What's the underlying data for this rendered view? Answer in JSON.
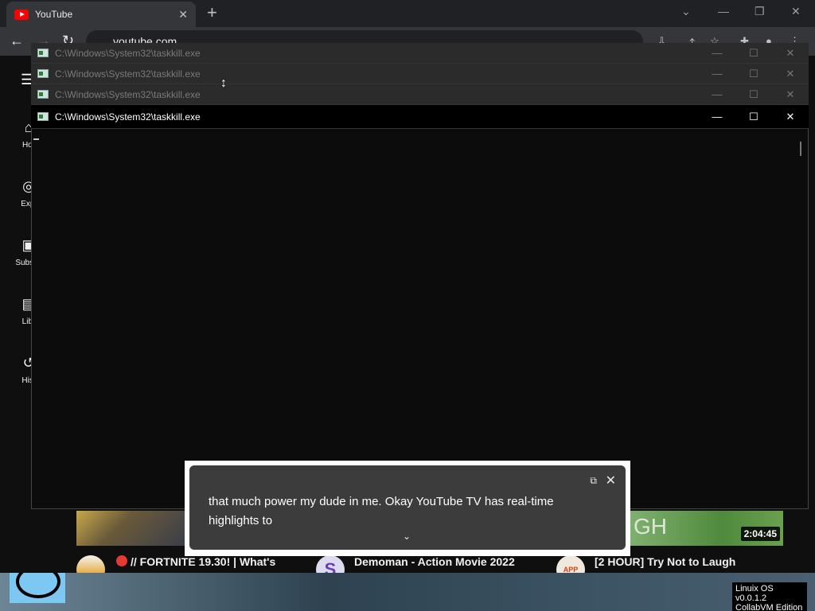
{
  "browser": {
    "tab_title": "YouTube",
    "tab_close": "✕",
    "new_tab": "+",
    "address": "youtube.com",
    "controls": {
      "dropdown": "⌄",
      "minimize": "—",
      "restore": "❐",
      "close": "✕"
    }
  },
  "youtube": {
    "sidebar": [
      {
        "label": "Hor",
        "icon": "home-icon"
      },
      {
        "label": "Expl",
        "icon": "explore-icon"
      },
      {
        "label": "Subscri",
        "icon": "subscriptions-icon"
      },
      {
        "label": "Libr",
        "icon": "library-icon"
      },
      {
        "label": "Hist",
        "icon": "history-icon"
      }
    ],
    "videos": [
      {
        "title": "// FORTNITE 19.30! | What's"
      },
      {
        "title": "Demoman - Action Movie 2022",
        "avatar_letter": "S"
      },
      {
        "title": "[2 HOUR] Try Not to Laugh",
        "avatar_text": "APP",
        "duration": "2:04:45",
        "thumb_text": "GH"
      }
    ]
  },
  "consoles": [
    {
      "title": "C:\\Windows\\System32\\taskkill.exe"
    },
    {
      "title": "C:\\Windows\\System32\\taskkill.exe"
    },
    {
      "title": "C:\\Windows\\System32\\taskkill.exe"
    },
    {
      "title": "C:\\Windows\\System32\\taskkill.exe"
    }
  ],
  "console_buttons": {
    "minimize": "—",
    "maximize": "☐",
    "close": "✕"
  },
  "caption": {
    "text": "that much power my dude in me. Okay YouTube TV has real-time highlights to",
    "popout": "⧉",
    "close": "✕",
    "expand": "⌄"
  },
  "watermark": {
    "line1": "Linuix OS v0.0.1.2",
    "line2": "CollabVM Edition"
  }
}
